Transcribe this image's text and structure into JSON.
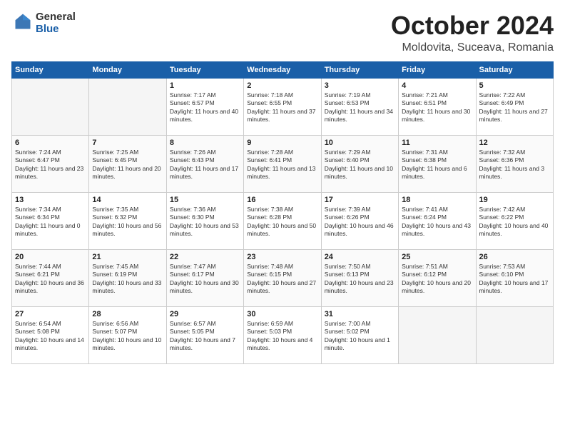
{
  "logo": {
    "general": "General",
    "blue": "Blue"
  },
  "header": {
    "month": "October 2024",
    "location": "Moldovita, Suceava, Romania"
  },
  "weekdays": [
    "Sunday",
    "Monday",
    "Tuesday",
    "Wednesday",
    "Thursday",
    "Friday",
    "Saturday"
  ],
  "weeks": [
    [
      {
        "day": "",
        "info": "",
        "empty": true
      },
      {
        "day": "",
        "info": "",
        "empty": true
      },
      {
        "day": "1",
        "info": "Sunrise: 7:17 AM\nSunset: 6:57 PM\nDaylight: 11 hours and 40 minutes."
      },
      {
        "day": "2",
        "info": "Sunrise: 7:18 AM\nSunset: 6:55 PM\nDaylight: 11 hours and 37 minutes."
      },
      {
        "day": "3",
        "info": "Sunrise: 7:19 AM\nSunset: 6:53 PM\nDaylight: 11 hours and 34 minutes."
      },
      {
        "day": "4",
        "info": "Sunrise: 7:21 AM\nSunset: 6:51 PM\nDaylight: 11 hours and 30 minutes."
      },
      {
        "day": "5",
        "info": "Sunrise: 7:22 AM\nSunset: 6:49 PM\nDaylight: 11 hours and 27 minutes."
      }
    ],
    [
      {
        "day": "6",
        "info": "Sunrise: 7:24 AM\nSunset: 6:47 PM\nDaylight: 11 hours and 23 minutes."
      },
      {
        "day": "7",
        "info": "Sunrise: 7:25 AM\nSunset: 6:45 PM\nDaylight: 11 hours and 20 minutes."
      },
      {
        "day": "8",
        "info": "Sunrise: 7:26 AM\nSunset: 6:43 PM\nDaylight: 11 hours and 17 minutes."
      },
      {
        "day": "9",
        "info": "Sunrise: 7:28 AM\nSunset: 6:41 PM\nDaylight: 11 hours and 13 minutes."
      },
      {
        "day": "10",
        "info": "Sunrise: 7:29 AM\nSunset: 6:40 PM\nDaylight: 11 hours and 10 minutes."
      },
      {
        "day": "11",
        "info": "Sunrise: 7:31 AM\nSunset: 6:38 PM\nDaylight: 11 hours and 6 minutes."
      },
      {
        "day": "12",
        "info": "Sunrise: 7:32 AM\nSunset: 6:36 PM\nDaylight: 11 hours and 3 minutes."
      }
    ],
    [
      {
        "day": "13",
        "info": "Sunrise: 7:34 AM\nSunset: 6:34 PM\nDaylight: 11 hours and 0 minutes."
      },
      {
        "day": "14",
        "info": "Sunrise: 7:35 AM\nSunset: 6:32 PM\nDaylight: 10 hours and 56 minutes."
      },
      {
        "day": "15",
        "info": "Sunrise: 7:36 AM\nSunset: 6:30 PM\nDaylight: 10 hours and 53 minutes."
      },
      {
        "day": "16",
        "info": "Sunrise: 7:38 AM\nSunset: 6:28 PM\nDaylight: 10 hours and 50 minutes."
      },
      {
        "day": "17",
        "info": "Sunrise: 7:39 AM\nSunset: 6:26 PM\nDaylight: 10 hours and 46 minutes."
      },
      {
        "day": "18",
        "info": "Sunrise: 7:41 AM\nSunset: 6:24 PM\nDaylight: 10 hours and 43 minutes."
      },
      {
        "day": "19",
        "info": "Sunrise: 7:42 AM\nSunset: 6:22 PM\nDaylight: 10 hours and 40 minutes."
      }
    ],
    [
      {
        "day": "20",
        "info": "Sunrise: 7:44 AM\nSunset: 6:21 PM\nDaylight: 10 hours and 36 minutes."
      },
      {
        "day": "21",
        "info": "Sunrise: 7:45 AM\nSunset: 6:19 PM\nDaylight: 10 hours and 33 minutes."
      },
      {
        "day": "22",
        "info": "Sunrise: 7:47 AM\nSunset: 6:17 PM\nDaylight: 10 hours and 30 minutes."
      },
      {
        "day": "23",
        "info": "Sunrise: 7:48 AM\nSunset: 6:15 PM\nDaylight: 10 hours and 27 minutes."
      },
      {
        "day": "24",
        "info": "Sunrise: 7:50 AM\nSunset: 6:13 PM\nDaylight: 10 hours and 23 minutes."
      },
      {
        "day": "25",
        "info": "Sunrise: 7:51 AM\nSunset: 6:12 PM\nDaylight: 10 hours and 20 minutes."
      },
      {
        "day": "26",
        "info": "Sunrise: 7:53 AM\nSunset: 6:10 PM\nDaylight: 10 hours and 17 minutes."
      }
    ],
    [
      {
        "day": "27",
        "info": "Sunrise: 6:54 AM\nSunset: 5:08 PM\nDaylight: 10 hours and 14 minutes."
      },
      {
        "day": "28",
        "info": "Sunrise: 6:56 AM\nSunset: 5:07 PM\nDaylight: 10 hours and 10 minutes."
      },
      {
        "day": "29",
        "info": "Sunrise: 6:57 AM\nSunset: 5:05 PM\nDaylight: 10 hours and 7 minutes."
      },
      {
        "day": "30",
        "info": "Sunrise: 6:59 AM\nSunset: 5:03 PM\nDaylight: 10 hours and 4 minutes."
      },
      {
        "day": "31",
        "info": "Sunrise: 7:00 AM\nSunset: 5:02 PM\nDaylight: 10 hours and 1 minute."
      },
      {
        "day": "",
        "info": "",
        "empty": true
      },
      {
        "day": "",
        "info": "",
        "empty": true
      }
    ]
  ]
}
